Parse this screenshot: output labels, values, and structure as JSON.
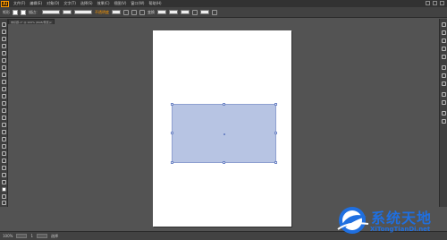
{
  "app": {
    "logo_text": "Ai"
  },
  "menu": {
    "items": [
      "文件(F)",
      "编辑(E)",
      "对象(O)",
      "文字(T)",
      "选择(S)",
      "效果(C)",
      "视图(V)",
      "窗口(W)",
      "帮助(H)"
    ]
  },
  "control_bar": {
    "selection_label": "矩形",
    "stroke_label": "描边：",
    "style_label": "不透明度：",
    "link_label": "不透明度",
    "align_label": "变换"
  },
  "document_tab": {
    "title": "未标题-1* @ 100% (RGB/预览)",
    "close": "×"
  },
  "status_bar": {
    "zoom": "100%",
    "page": "1",
    "status_text": "选择"
  },
  "shape": {
    "fill_color": "#b7c4e3",
    "stroke_color": "#8ea0d0"
  },
  "watermark": {
    "title": "系统天地",
    "url": "XiTongTianDi.net",
    "brand_color": "#1f6fe0"
  }
}
